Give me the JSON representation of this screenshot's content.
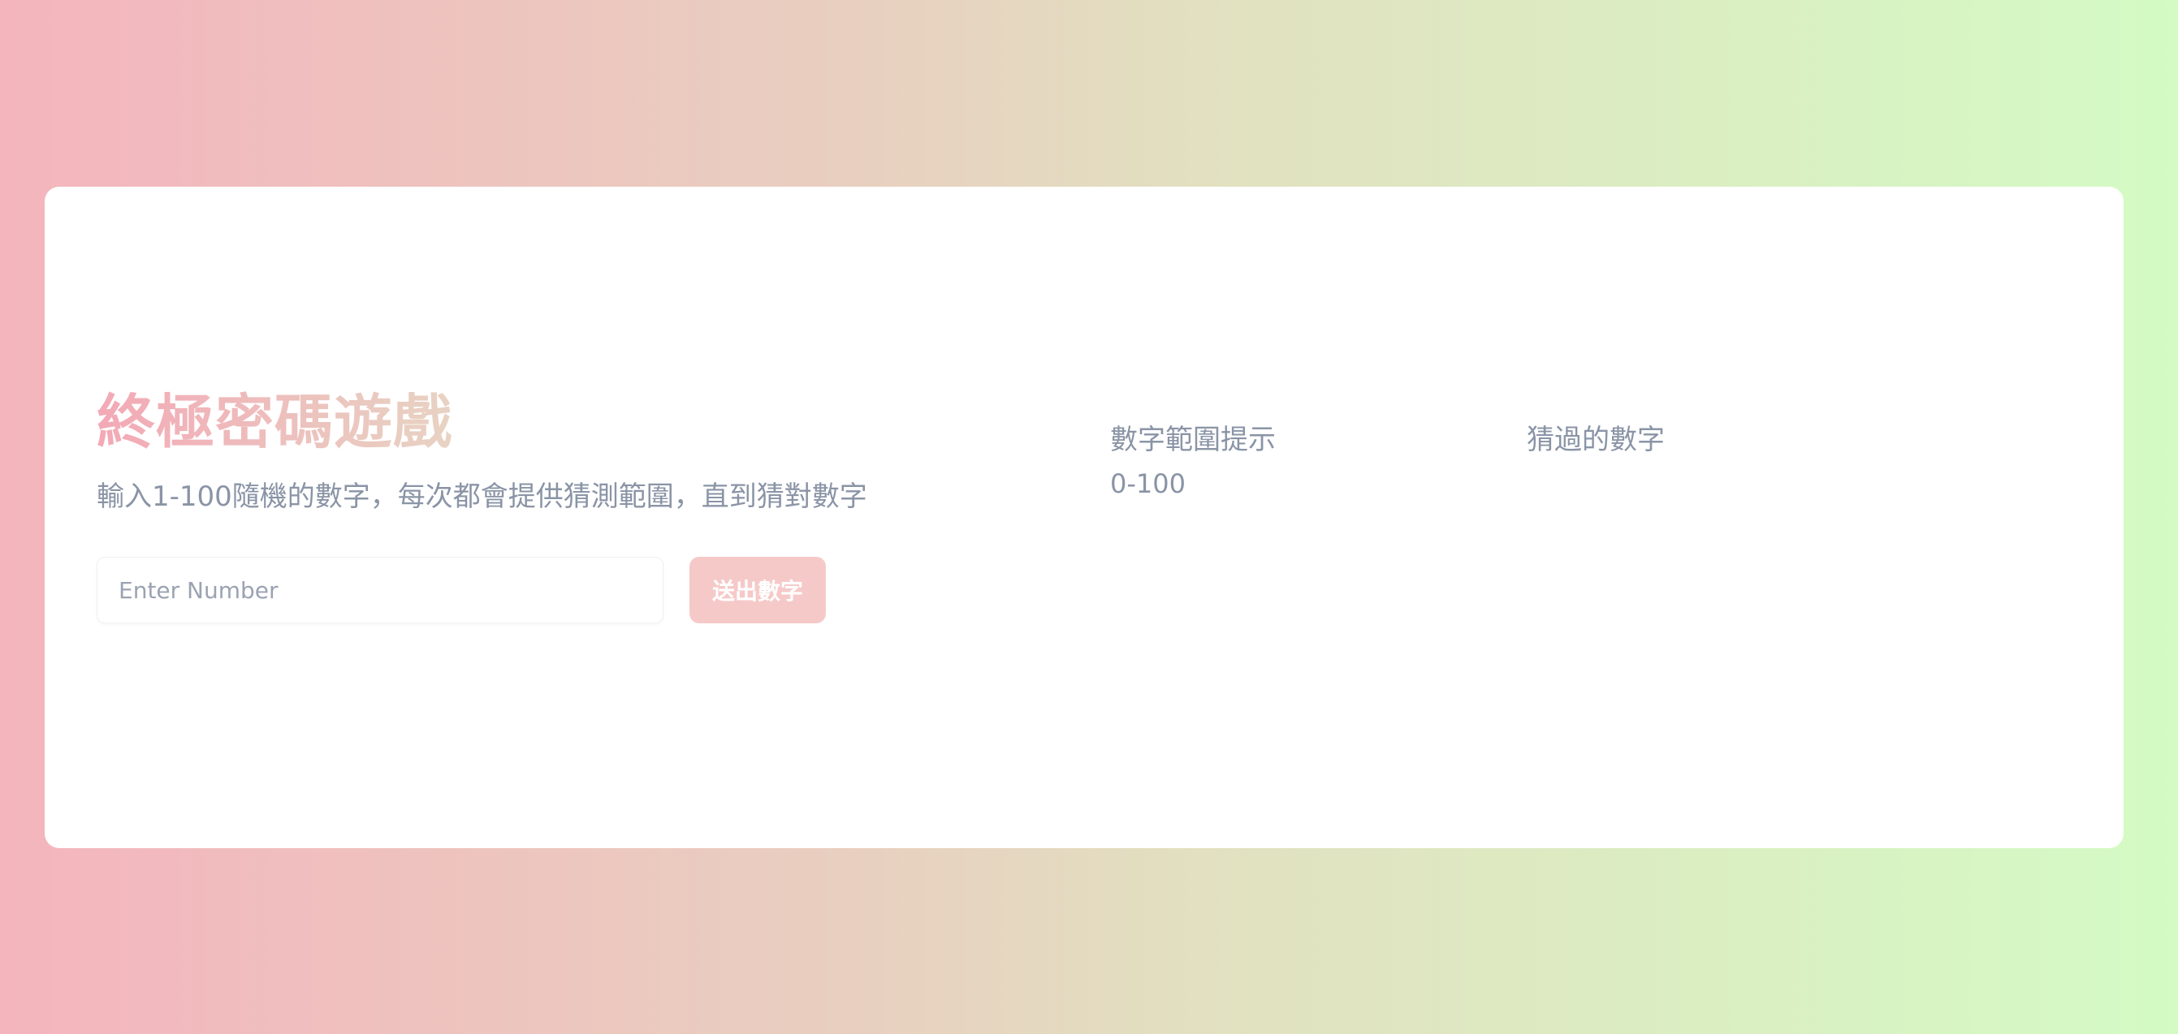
{
  "game": {
    "title": "終極密碼遊戲",
    "description": "輸入1-100隨機的數字，每次都會提供猜測範圍，直到猜對數字"
  },
  "form": {
    "input_value": "",
    "input_placeholder": "Enter Number",
    "submit_label": "送出數字"
  },
  "hint": {
    "heading": "數字範圍提示",
    "range": "0-100"
  },
  "guesses": {
    "heading": "猜過的數字",
    "items": []
  },
  "colors": {
    "accent": "#f6c9c9",
    "title_start": "#f3a9b6",
    "title_end": "#e8d3c3",
    "text_muted": "#8a94a6"
  }
}
